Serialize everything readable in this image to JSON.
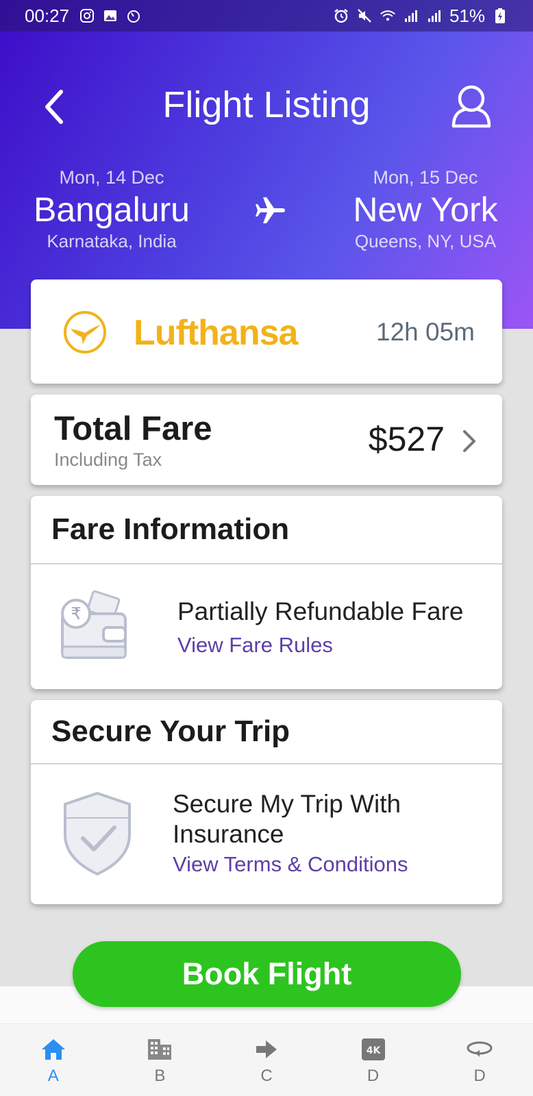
{
  "status_bar": {
    "time": "00:27",
    "battery": "51%",
    "left_icons": [
      "instagram-icon",
      "image-icon",
      "timer-icon"
    ],
    "right_icons": [
      "alarm-icon",
      "mute-icon",
      "wifi-icon",
      "signal-icon",
      "signal-icon",
      "battery-icon"
    ]
  },
  "header": {
    "title": "Flight Listing",
    "gradient_colors": [
      "#3d0cc7",
      "#9b55f5"
    ]
  },
  "route": {
    "from": {
      "date": "Mon, 14 Dec",
      "city": "Bangaluru",
      "region": "Karnataka, India"
    },
    "to": {
      "date": "Mon, 15 Dec",
      "city": "New York",
      "region": "Queens, NY, USA"
    }
  },
  "airline": {
    "name": "Lufthansa",
    "duration": "12h 05m",
    "brand_color": "#f2b21a"
  },
  "fare": {
    "title": "Total Fare",
    "subtitle": "Including Tax",
    "amount": "$527"
  },
  "fare_information": {
    "heading": "Fare Information",
    "text": "Partially Refundable Fare",
    "link": "View Fare Rules"
  },
  "secure_trip": {
    "heading": "Secure Your Trip",
    "text": "Secure My Trip With Insurance",
    "link": "View Terms & Conditions"
  },
  "book_button": {
    "label": "Book Flight",
    "color": "#2dc41f"
  },
  "tabs": [
    {
      "label": "A",
      "icon": "home-icon",
      "active": true
    },
    {
      "label": "B",
      "icon": "building-icon",
      "active": false
    },
    {
      "label": "C",
      "icon": "arrow-right-icon",
      "active": false
    },
    {
      "label": "D",
      "icon": "4k-icon",
      "active": false
    },
    {
      "label": "D",
      "icon": "rotate-icon",
      "active": false
    }
  ],
  "accent_color": "#2c8ef0",
  "link_color": "#5d3fa8"
}
